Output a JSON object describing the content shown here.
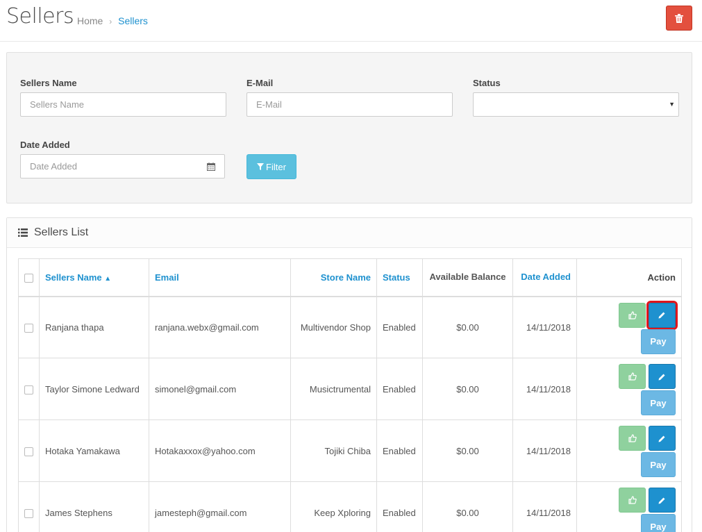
{
  "header": {
    "title": "Sellers",
    "breadcrumb": {
      "home": "Home",
      "separator": "›",
      "current": "Sellers"
    },
    "delete_icon": "trash-icon"
  },
  "filter": {
    "sellers_name_label": "Sellers Name",
    "sellers_name_placeholder": "Sellers Name",
    "email_label": "E-Mail",
    "email_placeholder": "E-Mail",
    "status_label": "Status",
    "status_value": "",
    "date_added_label": "Date Added",
    "date_added_placeholder": "Date Added",
    "filter_button": "Filter"
  },
  "list": {
    "title": "Sellers List",
    "columns": {
      "name": "Sellers Name",
      "email": "Email",
      "store": "Store Name",
      "status": "Status",
      "balance": "Available Balance",
      "date": "Date Added",
      "action": "Action"
    },
    "pay_label": "Pay",
    "rows": [
      {
        "name": "Ranjana thapa",
        "email": "ranjana.webx@gmail.com",
        "store": "Multivendor Shop",
        "status": "Enabled",
        "balance": "$0.00",
        "date": "14/11/2018"
      },
      {
        "name": "Taylor Simone Ledward",
        "email": "simonel@gmail.com",
        "store": "Musictrumental",
        "status": "Enabled",
        "balance": "$0.00",
        "date": "14/11/2018"
      },
      {
        "name": "Hotaka Yamakawa",
        "email": "Hotakaxxox@yahoo.com",
        "store": "Tojiki Chiba",
        "status": "Enabled",
        "balance": "$0.00",
        "date": "14/11/2018"
      },
      {
        "name": "James Stephens",
        "email": "jamesteph@gmail.com",
        "store": "Keep Xploring",
        "status": "Enabled",
        "balance": "$0.00",
        "date": "14/11/2018"
      }
    ]
  },
  "colors": {
    "primary": "#1e91cf",
    "danger": "#e3503e",
    "info": "#5bc0de",
    "success_light": "#8fd19e",
    "highlight": "#e0161c"
  }
}
